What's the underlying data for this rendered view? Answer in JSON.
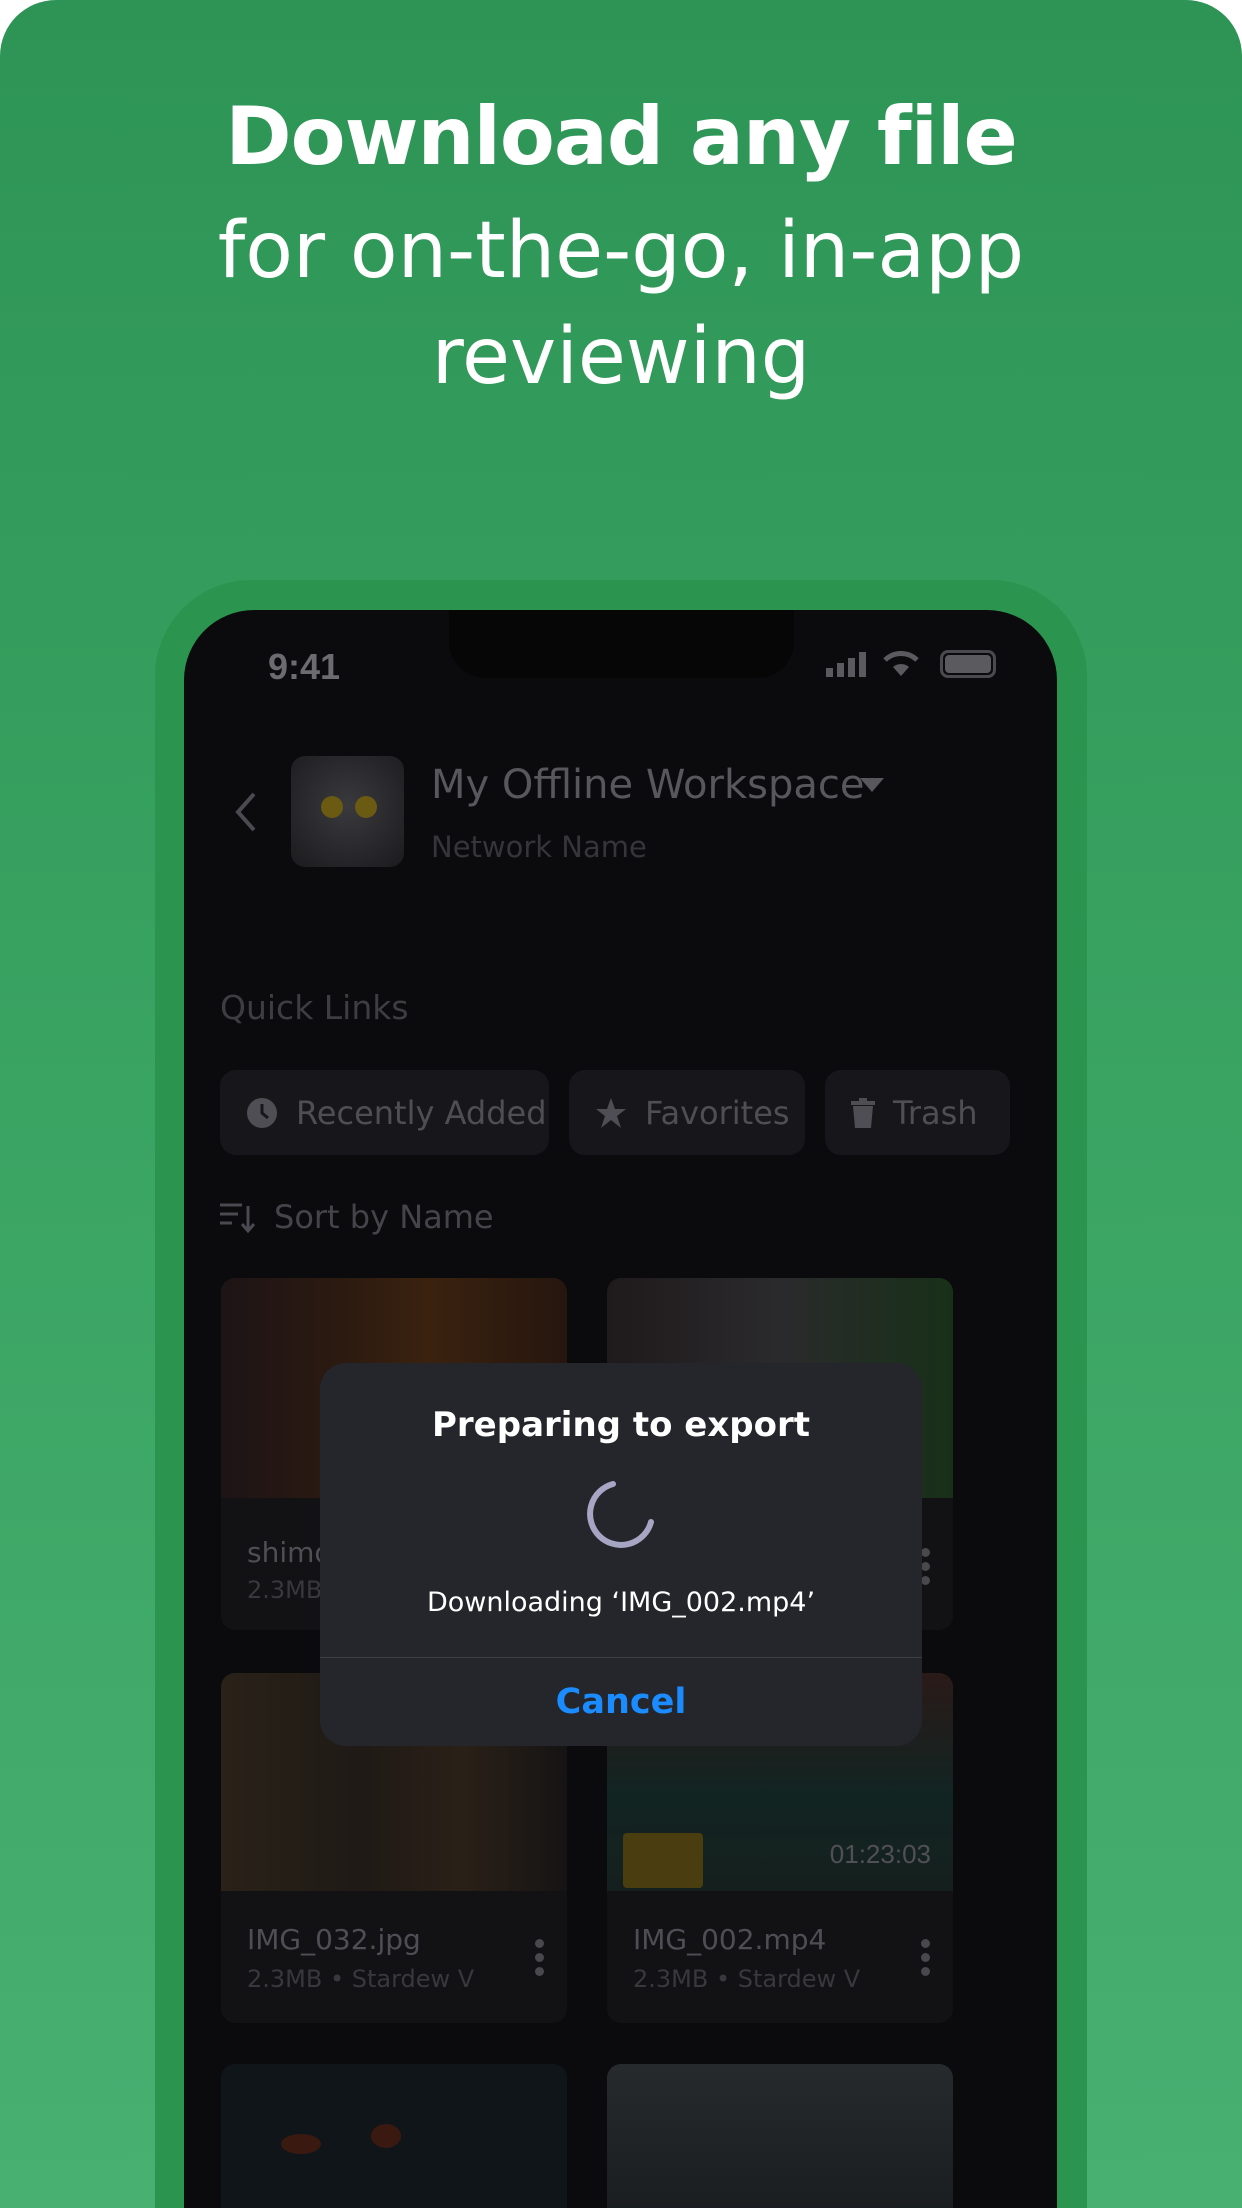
{
  "headline": {
    "line1": "Download any file",
    "line2": "for on-the-go, in-app",
    "line3": "reviewing"
  },
  "status": {
    "time": "9:41"
  },
  "header": {
    "title": "My Offline Workspace",
    "subtitle": "Network Name"
  },
  "quick_links": {
    "heading": "Quick Links",
    "items": [
      {
        "label": "Recently Added",
        "icon": "clock-icon"
      },
      {
        "label": "Favorites",
        "icon": "star-icon"
      },
      {
        "label": "Trash",
        "icon": "trash-icon"
      }
    ]
  },
  "sort": {
    "label": "Sort by Name"
  },
  "files": [
    {
      "name": "shimo",
      "meta": "2.3MB"
    },
    {
      "name": "",
      "meta": ""
    },
    {
      "name": "IMG_032.jpg",
      "meta": "2.3MB • Stardew V"
    },
    {
      "name": "IMG_002.mp4",
      "meta": "2.3MB • Stardew V",
      "duration": "01:23:03"
    }
  ],
  "dialog": {
    "title": "Preparing to export",
    "message": "Downloading ‘IMG_002.mp4’",
    "cancel": "Cancel"
  },
  "colors": {
    "accent": "#1a8cff",
    "background": "#2d9455"
  }
}
